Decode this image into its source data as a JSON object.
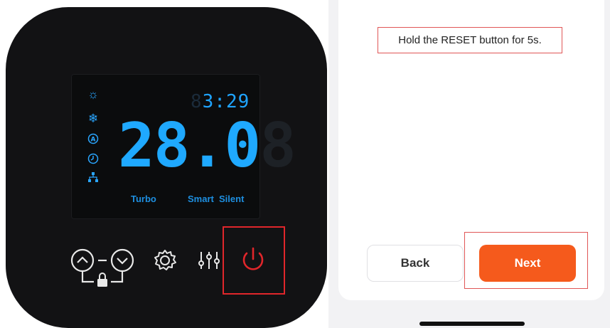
{
  "device": {
    "clock_dim_digit": "8",
    "clock_time": "3:29",
    "temperature": "28.0",
    "temperature_dim_digit": "8",
    "mode_icons": [
      "sun-icon",
      "snowflake-icon",
      "auto-mode-icon",
      "clock-icon",
      "network-icon"
    ],
    "labels": {
      "turbo": "Turbo",
      "smart": "Smart",
      "silent": "Silent"
    },
    "buttons": [
      "up-button",
      "down-button",
      "lock-icon",
      "settings-gear-button",
      "adjust-sliders-button",
      "power-button"
    ],
    "accent_lcd": "#1fa9ff",
    "power_color": "#e0262b"
  },
  "instruction": {
    "text": "Hold the RESET button for 5s."
  },
  "nav": {
    "back_label": "Back",
    "next_label": "Next"
  },
  "colors": {
    "next_button": "#f55a1c",
    "highlight": "#e0262b"
  }
}
